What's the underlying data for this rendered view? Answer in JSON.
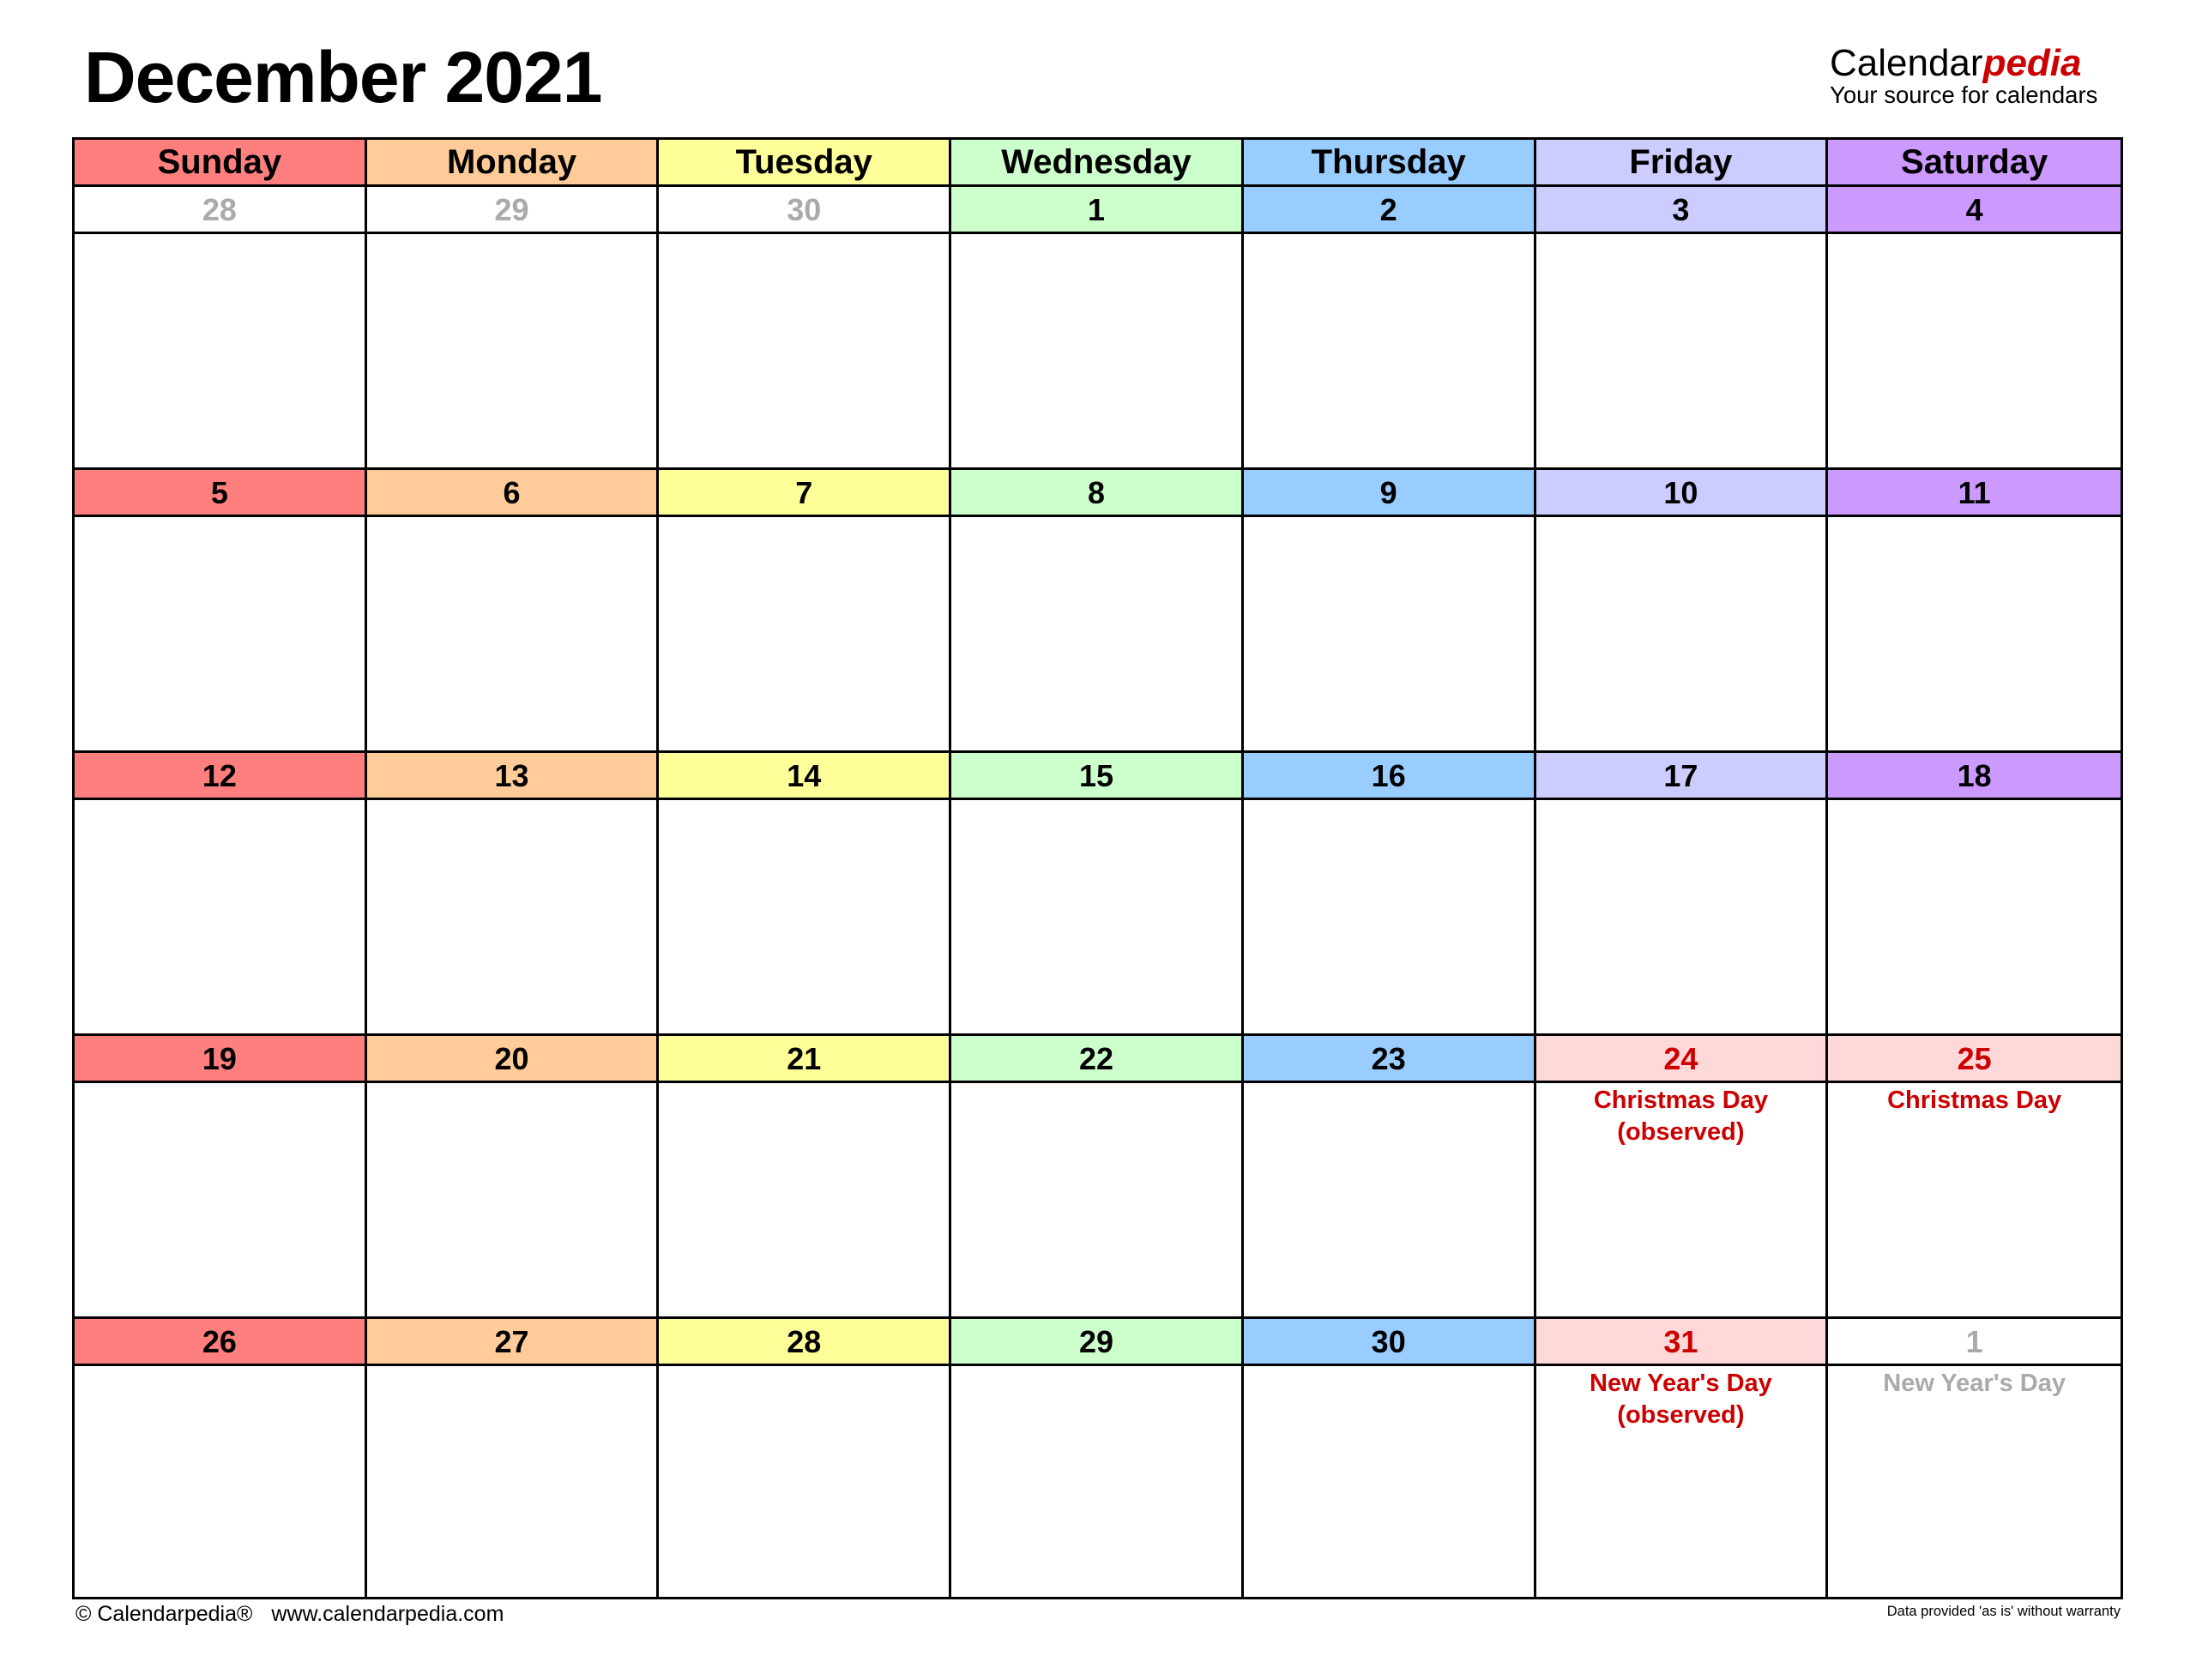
{
  "title": "December 2021",
  "brand": {
    "name_part1": "Calendar",
    "name_part2": "pedia",
    "tagline": "Your source for calendars",
    "accent_color": "#cc0000"
  },
  "weekdays": [
    {
      "label": "Sunday",
      "color": "#ff7f7f"
    },
    {
      "label": "Monday",
      "color": "#ffcc99"
    },
    {
      "label": "Tuesday",
      "color": "#ffff99"
    },
    {
      "label": "Wednesday",
      "color": "#ccffcc"
    },
    {
      "label": "Thursday",
      "color": "#99ccff"
    },
    {
      "label": "Friday",
      "color": "#ccccff"
    },
    {
      "label": "Saturday",
      "color": "#cc99ff"
    }
  ],
  "holiday_color": "#ffd9d9",
  "weeks": [
    [
      {
        "day": "28",
        "other_month": true
      },
      {
        "day": "29",
        "other_month": true
      },
      {
        "day": "30",
        "other_month": true
      },
      {
        "day": "1"
      },
      {
        "day": "2"
      },
      {
        "day": "3"
      },
      {
        "day": "4"
      }
    ],
    [
      {
        "day": "5"
      },
      {
        "day": "6"
      },
      {
        "day": "7"
      },
      {
        "day": "8"
      },
      {
        "day": "9"
      },
      {
        "day": "10"
      },
      {
        "day": "11"
      }
    ],
    [
      {
        "day": "12"
      },
      {
        "day": "13"
      },
      {
        "day": "14"
      },
      {
        "day": "15"
      },
      {
        "day": "16"
      },
      {
        "day": "17"
      },
      {
        "day": "18"
      }
    ],
    [
      {
        "day": "19"
      },
      {
        "day": "20"
      },
      {
        "day": "21"
      },
      {
        "day": "22"
      },
      {
        "day": "23"
      },
      {
        "day": "24",
        "holiday": true,
        "events": [
          "Christmas Day",
          "(observed)"
        ]
      },
      {
        "day": "25",
        "holiday": true,
        "events": [
          "Christmas Day"
        ]
      }
    ],
    [
      {
        "day": "26"
      },
      {
        "day": "27"
      },
      {
        "day": "28"
      },
      {
        "day": "29"
      },
      {
        "day": "30"
      },
      {
        "day": "31",
        "holiday": true,
        "events": [
          "New Year's Day",
          "(observed)"
        ]
      },
      {
        "day": "1",
        "other_month": true,
        "events": [
          "New Year's Day"
        ]
      }
    ]
  ],
  "footer": {
    "copyright": "© Calendarpedia®",
    "website": "www.calendarpedia.com",
    "disclaimer": "Data provided 'as is' without warranty"
  }
}
